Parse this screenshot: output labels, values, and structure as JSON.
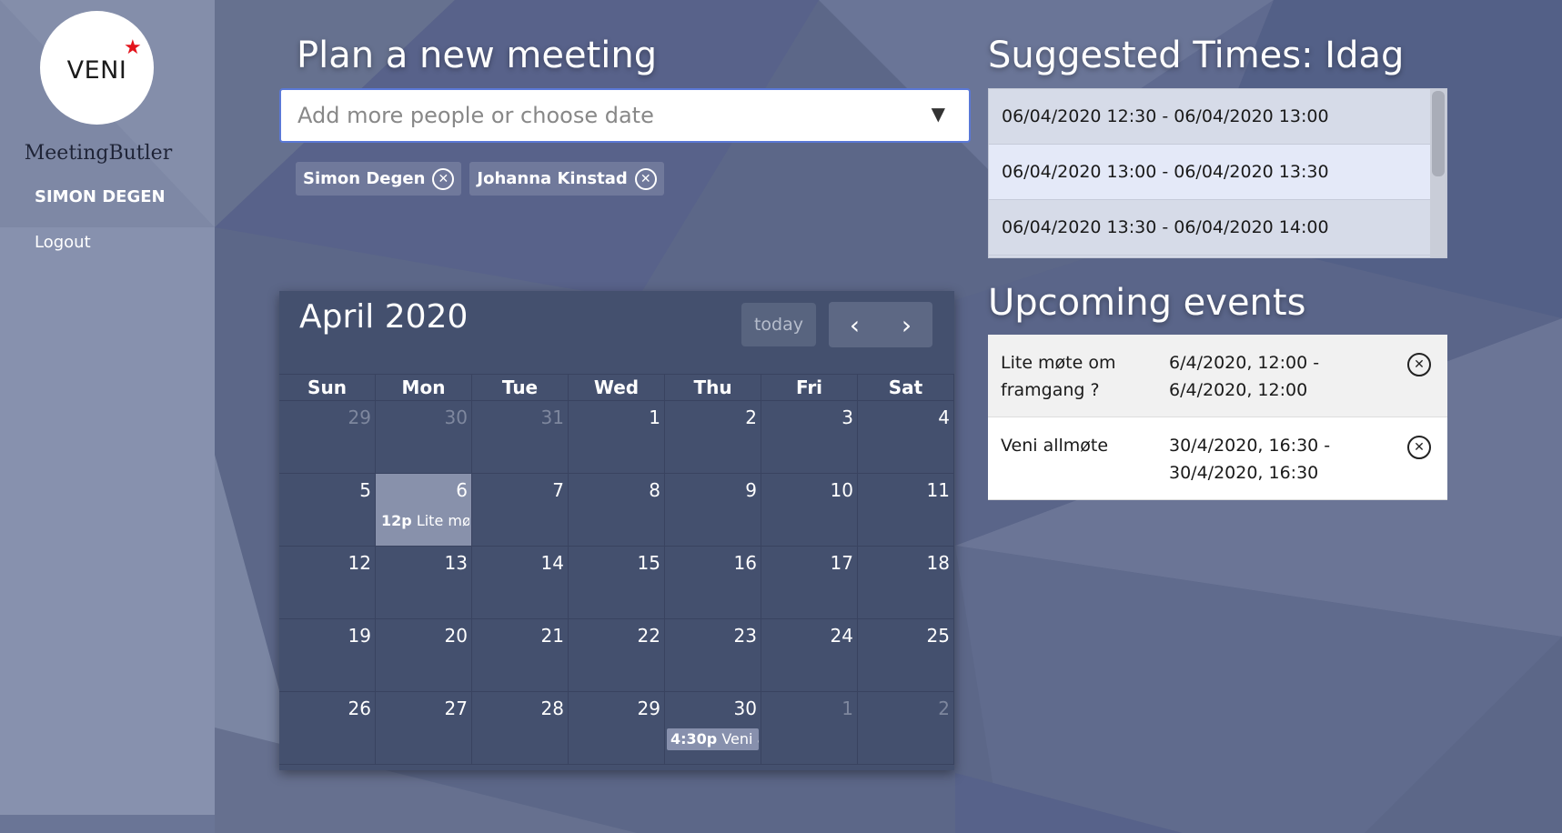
{
  "sidebar": {
    "logo_text": "VENI",
    "app_name": "MeetingButler",
    "user_name": "SIMON DEGEN",
    "logout_label": "Logout"
  },
  "plan": {
    "title": "Plan a new meeting",
    "input_placeholder": "Add more people or choose date",
    "participants": [
      "Simon Degen",
      "Johanna Kinstad"
    ]
  },
  "suggested": {
    "title": "Suggested Times: Idag",
    "items": [
      "06/04/2020 12:30 - 06/04/2020 13:00",
      "06/04/2020 13:00 - 06/04/2020 13:30",
      "06/04/2020 13:30 - 06/04/2020 14:00"
    ]
  },
  "upcoming": {
    "title": "Upcoming events",
    "events": [
      {
        "name": "Lite møte om framgang ?",
        "time": "6/4/2020, 12:00 - 6/4/2020, 12:00"
      },
      {
        "name": "Veni allmøte",
        "time": "30/4/2020, 16:30 - 30/4/2020, 16:30"
      }
    ]
  },
  "calendar": {
    "title": "April 2020",
    "today_label": "today",
    "prev_label": "‹",
    "next_label": "›",
    "weekdays": [
      "Sun",
      "Mon",
      "Tue",
      "Wed",
      "Thu",
      "Fri",
      "Sat"
    ],
    "weeks": [
      [
        "29",
        "30",
        "31",
        "1",
        "2",
        "3",
        "4"
      ],
      [
        "5",
        "6",
        "7",
        "8",
        "9",
        "10",
        "11"
      ],
      [
        "12",
        "13",
        "14",
        "15",
        "16",
        "17",
        "18"
      ],
      [
        "19",
        "20",
        "21",
        "22",
        "23",
        "24",
        "25"
      ],
      [
        "26",
        "27",
        "28",
        "29",
        "30",
        "1",
        "2"
      ]
    ],
    "event_1_time": "12p",
    "event_1_title": "Lite mø",
    "event_2_time": "4:30p",
    "event_2_title": "Veni a"
  },
  "colors": {
    "background": "#5c6788",
    "calendar_bg": "#44506e",
    "today_cell": "#8891ab",
    "input_border": "#5a78d6",
    "logo_star": "#e3141c"
  }
}
